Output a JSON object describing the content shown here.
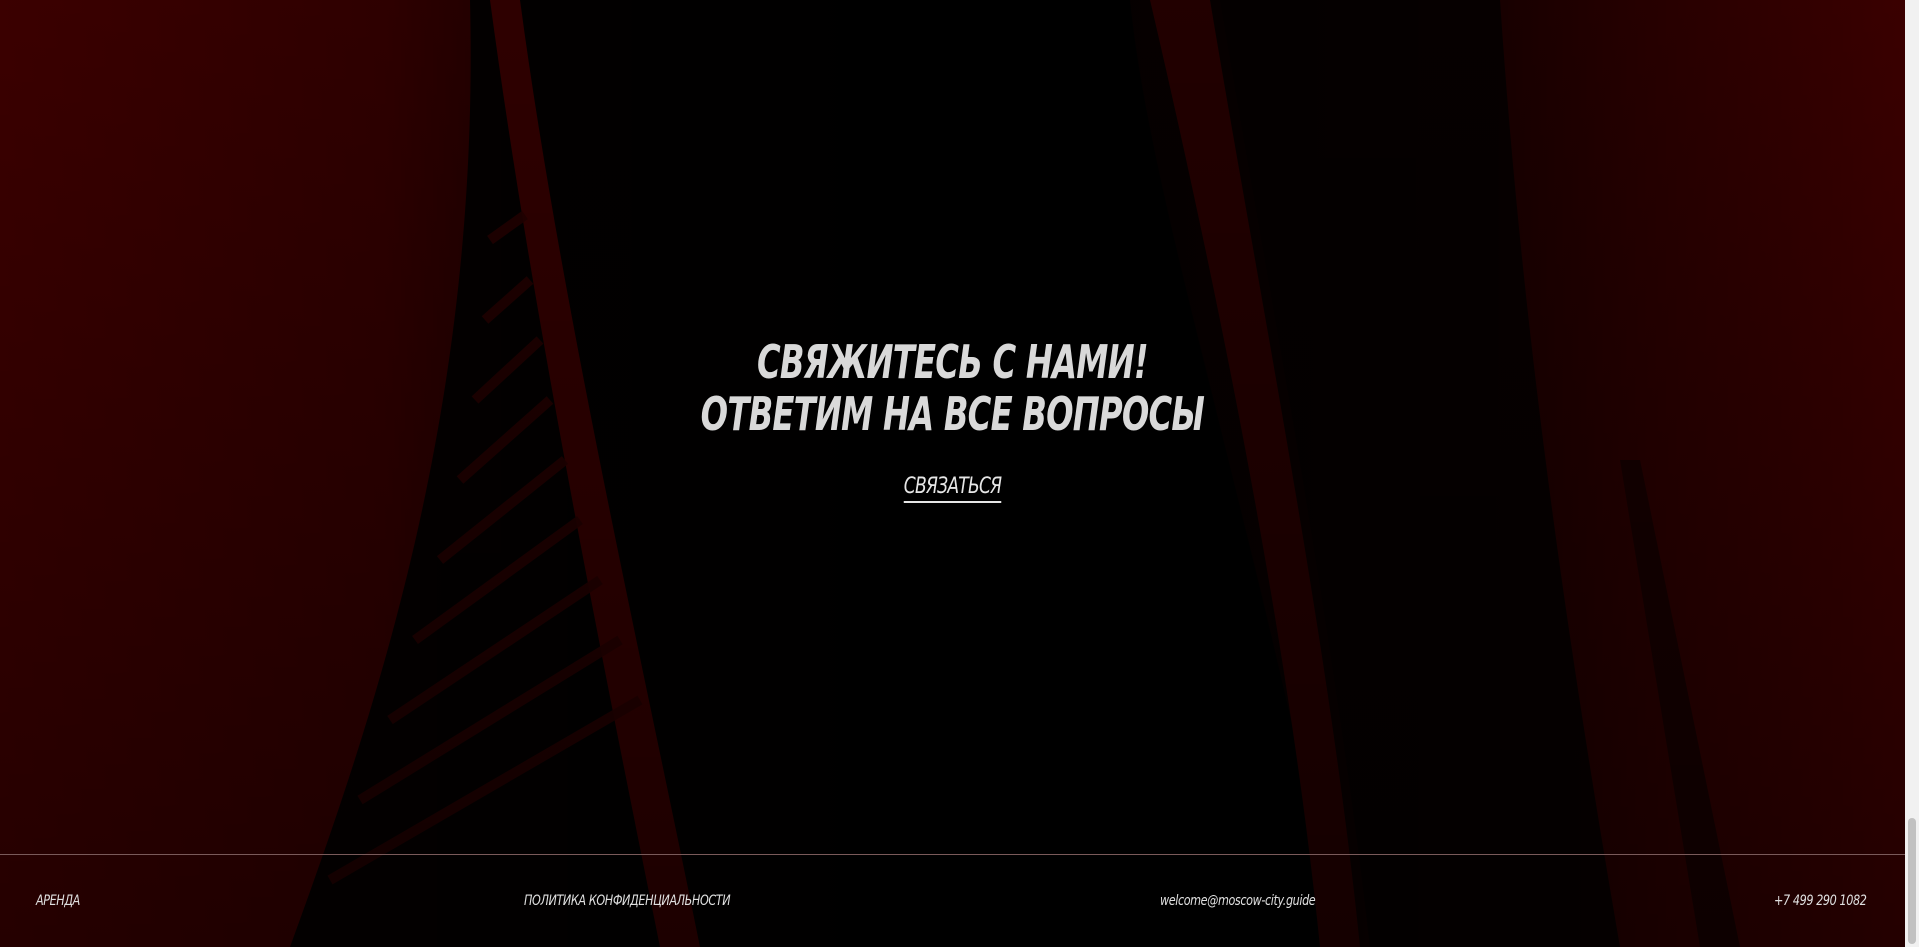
{
  "cta_section": {
    "headline_line1": "Свяжитесь с нами!",
    "headline_line2": "Ответим на все вопросы",
    "button_label": "СВЯЗАТЬСЯ"
  },
  "footer": {
    "rent_link": "АРЕНДА",
    "policy_link": "ПОЛИТИКА КОНФИДЕНЦИАЛЬНОСТИ",
    "email_link": "welcome@moscow-city.guide",
    "phone_link": "+7 499 290 1082"
  },
  "colors": {
    "accent_red": "#4a0000",
    "text": "#d9d9d9"
  }
}
